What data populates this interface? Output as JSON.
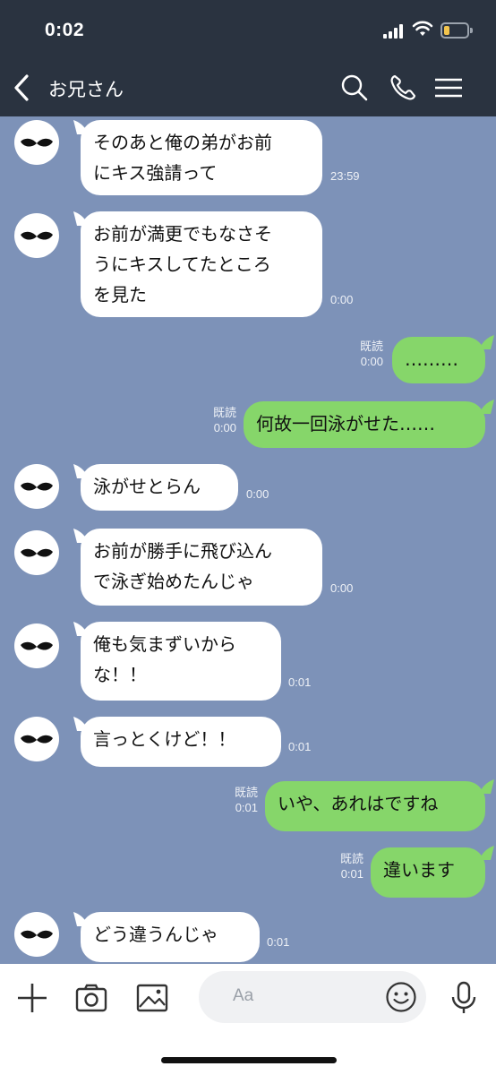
{
  "status_bar": {
    "time": "0:02",
    "battery_level": 0.2,
    "battery_color": "#f2c44d"
  },
  "header": {
    "back_icon": "chevron-left-icon",
    "title": "お兄さん",
    "icons": [
      "search-icon",
      "phone-icon",
      "menu-icon"
    ]
  },
  "messages": [
    {
      "side": "in",
      "lines": [
        "そのあと俺の弟がお前",
        "にキス強請って"
      ],
      "time": "23:59"
    },
    {
      "side": "in",
      "lines": [
        "お前が満更でもなさそ",
        "うにキスしてたところ",
        "を見た"
      ],
      "time": "0:00"
    },
    {
      "side": "out",
      "lines": [
        "………"
      ],
      "read": "既読",
      "time": "0:00"
    },
    {
      "side": "out",
      "lines": [
        "何故一回泳がせた……"
      ],
      "read": "既読",
      "time": "0:00"
    },
    {
      "side": "in",
      "lines": [
        "泳がせとらん"
      ],
      "time": "0:00"
    },
    {
      "side": "in",
      "lines": [
        "お前が勝手に飛び込ん",
        "で泳ぎ始めたんじゃ"
      ],
      "time": "0:00"
    },
    {
      "side": "in",
      "lines": [
        "俺も気まずいから",
        "な！！"
      ],
      "time": "0:01"
    },
    {
      "side": "in",
      "lines": [
        "言っとくけど！！"
      ],
      "time": "0:01"
    },
    {
      "side": "out",
      "lines": [
        "いや、あれはですね"
      ],
      "read": "既読",
      "time": "0:01"
    },
    {
      "side": "out",
      "lines": [
        "違います"
      ],
      "read": "既読",
      "time": "0:01"
    },
    {
      "side": "in",
      "lines": [
        "どう違うんじゃ"
      ],
      "time": "0:01"
    }
  ],
  "composer": {
    "placeholder": "Aa",
    "icons": [
      "plus-icon",
      "camera-icon",
      "image-icon",
      "emoji-icon",
      "microphone-icon"
    ]
  },
  "colors": {
    "header_bg": "#2a3340",
    "chat_bg": "#7d92b8",
    "out_bubble": "#86d66a",
    "in_bubble": "#ffffff"
  }
}
